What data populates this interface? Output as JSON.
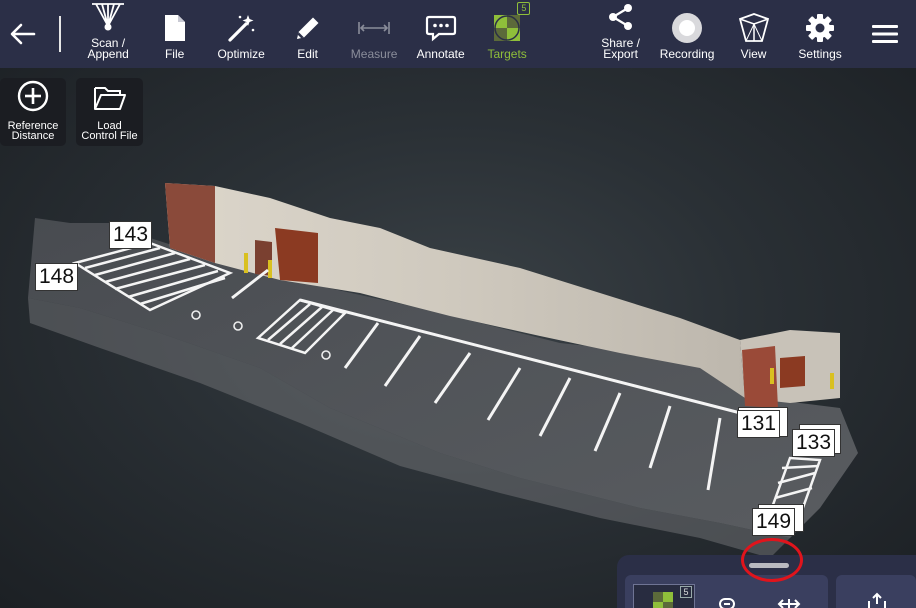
{
  "toolbar": {
    "back_icon": "arrow-left-icon",
    "items": [
      {
        "id": "scan",
        "label": "Scan /\nAppend",
        "icon": "scanner-icon",
        "state": "normal"
      },
      {
        "id": "file",
        "label": "File",
        "icon": "file-icon",
        "state": "normal"
      },
      {
        "id": "optimize",
        "label": "Optimize",
        "icon": "magic-wand-icon",
        "state": "normal"
      },
      {
        "id": "edit",
        "label": "Edit",
        "icon": "pencil-icon",
        "state": "normal"
      },
      {
        "id": "measure",
        "label": "Measure",
        "icon": "measure-icon",
        "state": "disabled"
      },
      {
        "id": "annotate",
        "label": "Annotate",
        "icon": "speech-bubble-icon",
        "state": "normal"
      },
      {
        "id": "targets",
        "label": "Targets",
        "icon": "target-checker-icon",
        "state": "active",
        "badge": "5"
      },
      {
        "id": "share",
        "label": "Share /\nExport",
        "icon": "share-icon",
        "state": "normal"
      },
      {
        "id": "recording",
        "label": "Recording",
        "icon": "record-icon",
        "state": "normal"
      },
      {
        "id": "view",
        "label": "View",
        "icon": "cube-icon",
        "state": "normal"
      },
      {
        "id": "settings",
        "label": "Settings",
        "icon": "gear-icon",
        "state": "normal"
      }
    ],
    "menu_icon": "hamburger-menu-icon",
    "accent_color": "#8fbf3a",
    "background_color": "#2b2f47"
  },
  "quick_actions": {
    "reference_distance": {
      "label": "Reference\nDistance",
      "icon": "plus-circle-icon"
    },
    "load_control_file": {
      "label": "Load\nControl File",
      "icon": "folder-open-icon"
    }
  },
  "point_labels": [
    {
      "id": "143",
      "text": "143"
    },
    {
      "id": "148",
      "text": "148"
    },
    {
      "id": "131",
      "text": "131"
    },
    {
      "id": "133",
      "text": "133"
    },
    {
      "id": "149",
      "text": "149"
    }
  ],
  "drawer": {
    "thumbnail_badge": "5",
    "highlight_color": "#e0141c",
    "icons": [
      "target-thumbnail-icon",
      "link-icon",
      "resize-horizontal-icon",
      "export-icon"
    ]
  }
}
